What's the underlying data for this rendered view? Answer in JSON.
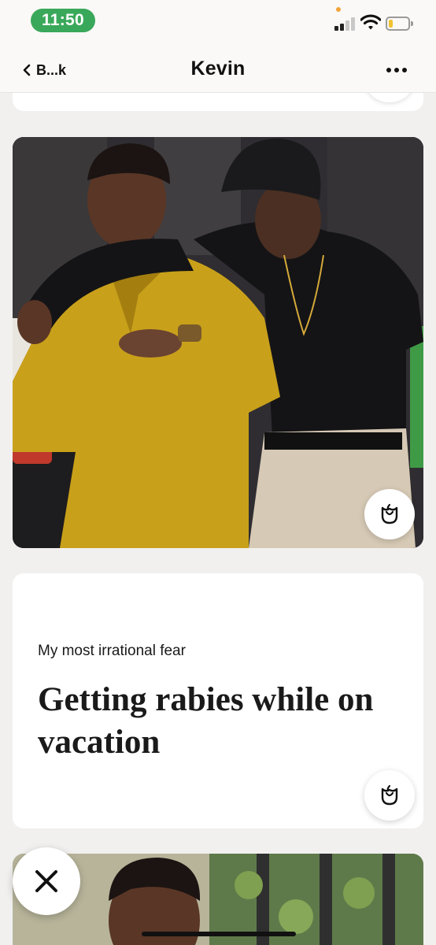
{
  "status_bar": {
    "time": "11:50",
    "signal_bars_active": 2,
    "signal_bars_total": 4,
    "battery_level": 0.2,
    "battery_color": "#f2c233",
    "time_pill_color": "#3aa85a"
  },
  "header": {
    "back_label": "B...k",
    "title": "Kevin",
    "more_icon": "ellipsis-icon"
  },
  "photo_card": {
    "like_icon": "rose-icon"
  },
  "prompt_card": {
    "question": "My most irrational fear",
    "answer": "Getting rabies while on vacation",
    "like_icon": "rose-icon"
  },
  "actions": {
    "dismiss_icon": "close-x-icon"
  }
}
